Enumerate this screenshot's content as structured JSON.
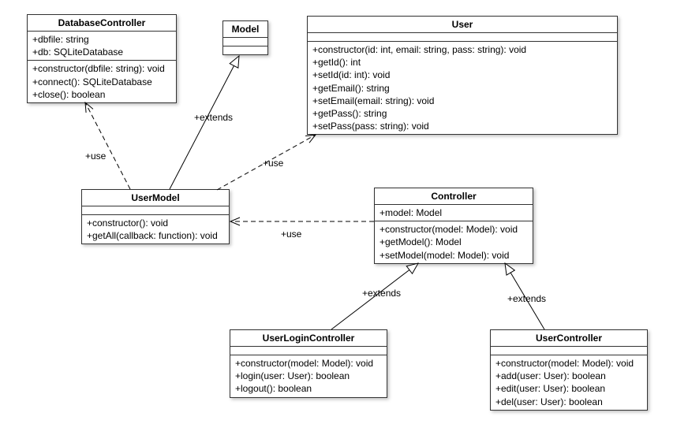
{
  "classes": {
    "databaseController": {
      "name": "DatabaseController",
      "attrs": [
        "+dbfile: string",
        "+db: SQLiteDatabase"
      ],
      "ops": [
        "+constructor(dbfile: string): void",
        "+connect(): SQLiteDatabase",
        "+close(): boolean"
      ]
    },
    "model": {
      "name": "Model",
      "attrs": [],
      "ops": []
    },
    "user": {
      "name": "User",
      "attrs": [],
      "ops": [
        "+constructor(id: int, email: string, pass: string): void",
        "+getId(): int",
        "+setId(id: int): void",
        "+getEmail(): string",
        "+setEmail(email: string): void",
        "+getPass(): string",
        "+setPass(pass: string): void"
      ]
    },
    "userModel": {
      "name": "UserModel",
      "attrs": [],
      "ops": [
        "+constructor(): void",
        "+getAll(callback: function): void"
      ]
    },
    "controller": {
      "name": "Controller",
      "attrs": [
        "+model: Model"
      ],
      "ops": [
        "+constructor(model: Model): void",
        "+getModel(): Model",
        "+setModel(model: Model): void"
      ]
    },
    "userLoginController": {
      "name": "UserLoginController",
      "attrs": [],
      "ops": [
        "+constructor(model: Model): void",
        "+login(user: User): boolean",
        "+logout(): boolean"
      ]
    },
    "userController": {
      "name": "UserController",
      "attrs": [],
      "ops": [
        "+constructor(model: Model): void",
        "+add(user: User): boolean",
        "+edit(user: User): boolean",
        "+del(user: User): boolean"
      ]
    }
  },
  "relations": {
    "r0": {
      "label": "+use",
      "from": "UserModel",
      "to": "DatabaseController",
      "type": "dependency"
    },
    "r1": {
      "label": "+extends",
      "from": "UserModel",
      "to": "Model",
      "type": "generalization"
    },
    "r2": {
      "label": "+use",
      "from": "UserModel",
      "to": "User",
      "type": "dependency"
    },
    "r3": {
      "label": "+use",
      "from": "Controller",
      "to": "UserModel",
      "type": "dependency"
    },
    "r4": {
      "label": "+extends",
      "from": "UserLoginController",
      "to": "Controller",
      "type": "generalization"
    },
    "r5": {
      "label": "+extends",
      "from": "UserController",
      "to": "Controller",
      "type": "generalization"
    }
  }
}
